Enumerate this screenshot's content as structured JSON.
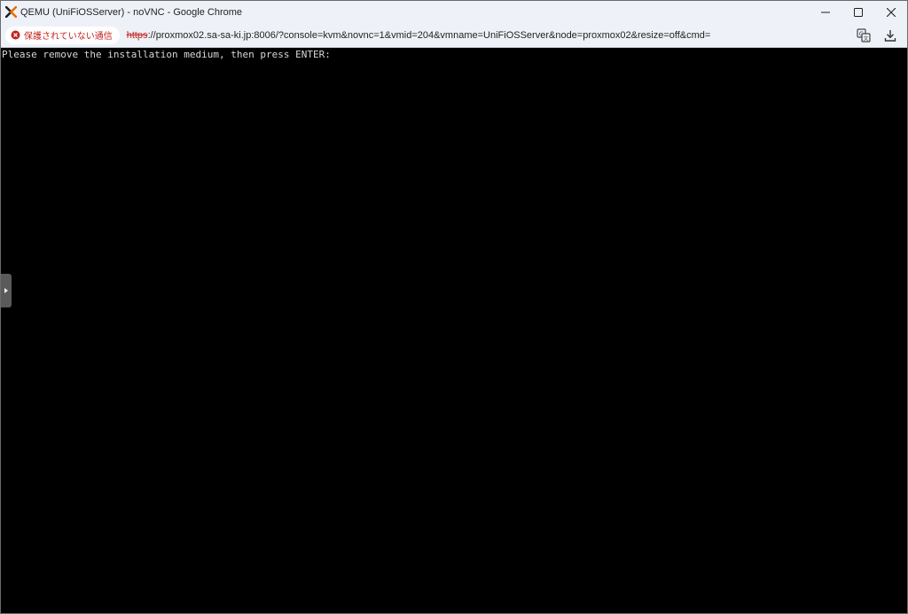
{
  "window": {
    "title": "QEMU (UniFiOSServer) - noVNC - Google Chrome",
    "app_icon": "proxmox-x-logo-icon",
    "controls": [
      "minimize-icon",
      "maximize-icon",
      "close-icon"
    ]
  },
  "addressbar": {
    "security_label": "保護されていない通信",
    "security_icon": "not-secure-icon",
    "url_scheme": "https",
    "url_rest": "://proxmox02.sa-sa-ki.jp:8006/?console=kvm&novnc=1&vmid=204&vmname=UniFiOSServer&node=proxmox02&resize=off&cmd=",
    "right_icons": [
      "translate-icon",
      "download-icon"
    ]
  },
  "console": {
    "line": "Please remove the installation medium, then press ENTER:",
    "text_color": "#d8d8d8",
    "background": "#000000"
  },
  "novnc_sidebar": {
    "icon": "expand-arrow-icon"
  },
  "colors": {
    "chrome_bg": "#eef2f8",
    "warning_red": "#c5221f"
  }
}
